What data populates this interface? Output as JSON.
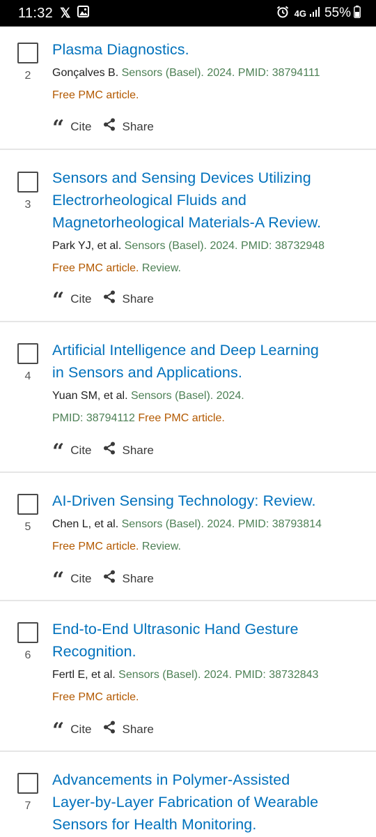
{
  "status_bar": {
    "time": "11:32",
    "network": "4G",
    "battery": "55%"
  },
  "actions": {
    "cite": "Cite",
    "share": "Share"
  },
  "results": [
    {
      "num": "2",
      "title_lines": [
        "Plasma Diagnostics."
      ],
      "meta_lines": [
        [
          {
            "t": "Gonçalves B. ",
            "c": "authors"
          },
          {
            "t": "Sensors (Basel). 2024. PMID: 38794111",
            "c": "journal"
          }
        ],
        [
          {
            "t": "Free PMC article.",
            "c": "free"
          }
        ]
      ]
    },
    {
      "num": "3",
      "title_lines": [
        "Sensors and Sensing Devices Utilizing",
        "Electrorheological Fluids and",
        "Magnetorheological Materials-A Review."
      ],
      "meta_lines": [
        [
          {
            "t": "Park YJ, et al. ",
            "c": "authors"
          },
          {
            "t": "Sensors (Basel). 2024. PMID: 38732948",
            "c": "journal"
          }
        ],
        [
          {
            "t": "Free PMC article.",
            "c": "free"
          },
          {
            "t": " Review.",
            "c": "review"
          }
        ]
      ]
    },
    {
      "num": "4",
      "title_lines": [
        "Artificial Intelligence and Deep Learning",
        "in Sensors and Applications."
      ],
      "meta_lines": [
        [
          {
            "t": "Yuan SM, et al. ",
            "c": "authors"
          },
          {
            "t": "Sensors (Basel). 2024.",
            "c": "journal"
          }
        ],
        [
          {
            "t": "PMID: 38794112 ",
            "c": "journal"
          },
          {
            "t": "Free PMC article.",
            "c": "free"
          }
        ]
      ]
    },
    {
      "num": "5",
      "title_lines": [
        "AI-Driven Sensing Technology: Review."
      ],
      "meta_lines": [
        [
          {
            "t": "Chen L, et al. ",
            "c": "authors"
          },
          {
            "t": "Sensors (Basel). 2024. PMID: 38793814",
            "c": "journal"
          }
        ],
        [
          {
            "t": "Free PMC article.",
            "c": "free"
          },
          {
            "t": " Review.",
            "c": "review"
          }
        ]
      ]
    },
    {
      "num": "6",
      "title_lines": [
        "End-to-End Ultrasonic Hand Gesture",
        "Recognition."
      ],
      "meta_lines": [
        [
          {
            "t": "Fertl E, et al. ",
            "c": "authors"
          },
          {
            "t": "Sensors (Basel). 2024. PMID: 38732843",
            "c": "journal"
          }
        ],
        [
          {
            "t": "Free PMC article.",
            "c": "free"
          }
        ]
      ]
    },
    {
      "num": "7",
      "title_lines": [
        "Advancements in Polymer-Assisted",
        "Layer-by-Layer Fabrication of Wearable",
        "Sensors for Health Monitoring."
      ],
      "meta_lines": []
    }
  ]
}
